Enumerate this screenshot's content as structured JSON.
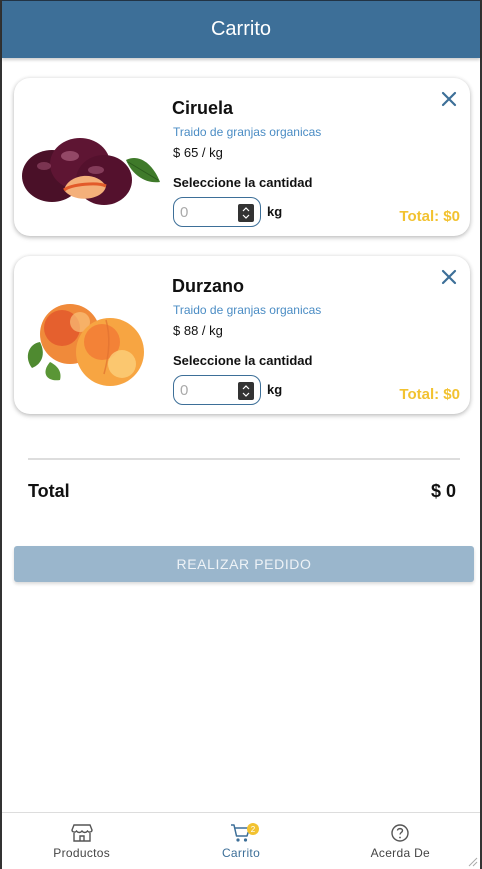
{
  "header": {
    "title": "Carrito"
  },
  "cart": {
    "items": [
      {
        "name": "Ciruela",
        "origin": "Traido de granjas organicas",
        "price": "$ 65 / kg",
        "quantity_label": "Seleccione la cantidad",
        "quantity_placeholder": "0",
        "unit": "kg",
        "total": "Total: $0",
        "image_icon": "plum-fruit-image"
      },
      {
        "name": "Durzano",
        "origin": "Traido de granjas organicas",
        "price": "$ 88 / kg",
        "quantity_label": "Seleccione la cantidad",
        "quantity_placeholder": "0",
        "unit": "kg",
        "total": "Total: $0",
        "image_icon": "peach-fruit-image"
      }
    ],
    "summary": {
      "total_label": "Total",
      "total_value": "$ 0"
    },
    "order_button": "REALIZAR PEDIDO"
  },
  "nav": {
    "items": [
      {
        "label": "Productos",
        "icon": "store-icon"
      },
      {
        "label": "Carrito",
        "icon": "cart-icon",
        "badge": "2",
        "active": true
      },
      {
        "label": "Acerda De",
        "icon": "help-circle-icon"
      }
    ]
  },
  "colors": {
    "primary": "#3d6f98",
    "accent": "#f2c230",
    "link": "#4a8cc4",
    "button_disabled": "#9ab6cc"
  }
}
